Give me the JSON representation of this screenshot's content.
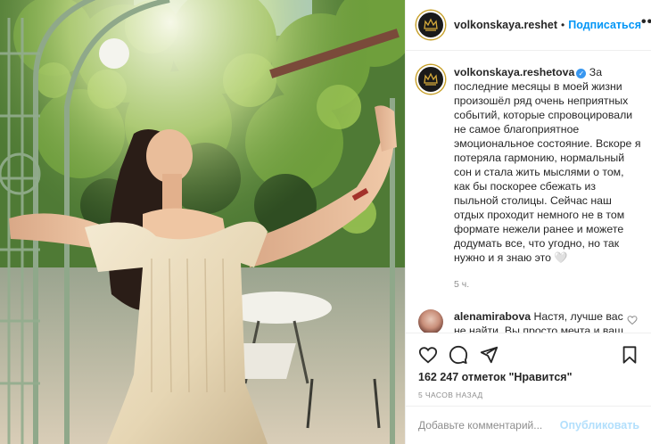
{
  "post": {
    "photo_alt": "",
    "author": "volkonskaya.reshet",
    "follow_label": "Подписаться",
    "dot": "•",
    "more_label": "•••"
  },
  "caption": {
    "username": "volkonskaya.reshetova",
    "verified": true,
    "text": "За последние месяцы в моей жизни произошёл ряд очень неприятных событий, которые спровоцировали не самое благоприятное эмоциональное состояние. Вскоре я потеряла гармонию, нормальный сон и стала жить мыслями о том, как бы поскорее сбежать из пыльной столицы. Сейчас наш отдых проходит немного не в том формате нежели ранее и можете додумать все, что угодно, но так нужно и я знаю это 🤍",
    "time": "5 ч."
  },
  "comment": {
    "username": "alenamirabova",
    "text": "Настя, лучше вас не найти. Вы просто мечта и ваш сын самый прекрасный"
  },
  "actions": {
    "icons": [
      "heart-icon",
      "comment-icon",
      "share-icon",
      "bookmark-icon"
    ],
    "likes": "162 247 отметок \"Нравится\"",
    "time_ago": "5 ЧАСОВ НАЗАД"
  },
  "add_comment": {
    "placeholder": "Добавьте комментарий...",
    "value": "",
    "publish_label": "Опубликовать"
  },
  "colors": {
    "accent": "#0095f6",
    "publish_disabled": "#b2dffc",
    "muted": "#8e8e8e",
    "verified": "#3897f0"
  }
}
